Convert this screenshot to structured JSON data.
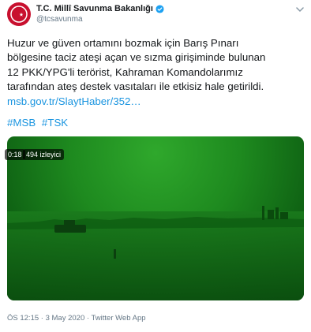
{
  "account": {
    "name": "T.C. Millî Savunma Bakanlığı",
    "handle": "@tcsavunma"
  },
  "tweet": {
    "text": "Huzur ve güven ortamını bozmak için Barış Pınarı\nbölgesine taciz ateşi açan ve sızma girişiminde bulunan\n12 PKK/YPG'li terörist, Kahraman Komandolarımız\ntarafından ateş destek vasıtaları ile etkisiz hale getirildi.",
    "link": "msb.gov.tr/SlaytHaber/352…",
    "hashtags": [
      "#MSB",
      "#TSK"
    ]
  },
  "media": {
    "duration": "0:18",
    "views": "494 izleyici"
  },
  "footer": {
    "timestamp": "ÖS 12:15 · 3 May 2020",
    "separator": "·",
    "source": "Twitter Web App"
  },
  "colors": {
    "link": "#1b95e0",
    "verified": "#1da1f2",
    "avatar": "#c8102e",
    "night_vision": "#1e8a1f"
  },
  "icons": [
    "msb-logo-icon",
    "verified-badge-icon",
    "chevron-down-icon"
  ]
}
